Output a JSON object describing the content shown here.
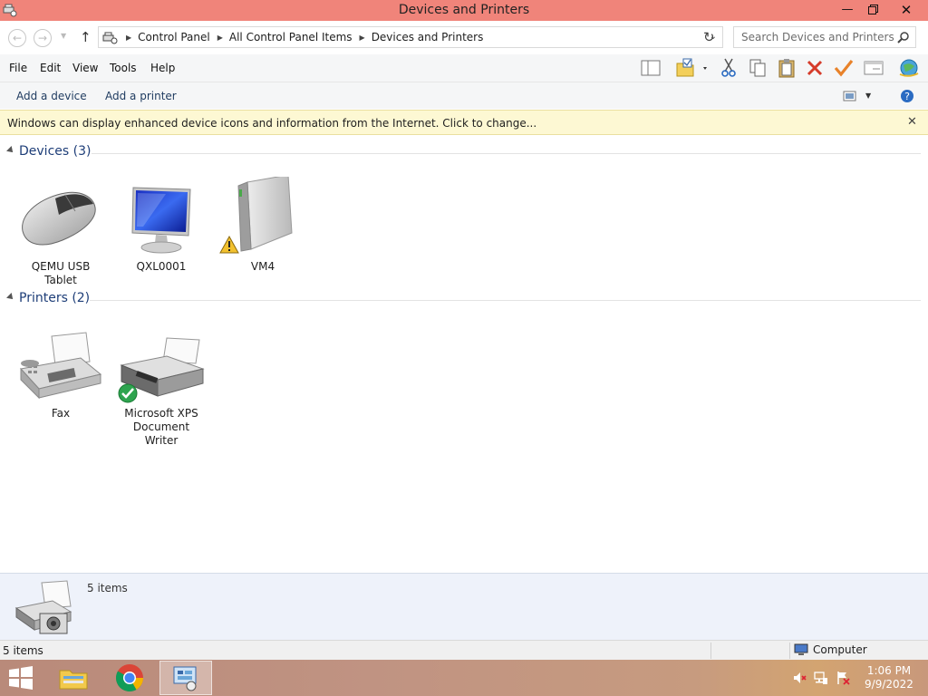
{
  "window": {
    "title": "Devices and Printers"
  },
  "address": {
    "breadcrumbs": [
      "Control Panel",
      "All Control Panel Items",
      "Devices and Printers"
    ],
    "search_placeholder": "Search Devices and Printers"
  },
  "menu": [
    "File",
    "Edit",
    "View",
    "Tools",
    "Help"
  ],
  "toolbar_icons": [
    "layout-icon",
    "folder-options-icon",
    "cut-icon",
    "copy-icon",
    "paste-icon",
    "delete-icon",
    "properties-check-icon",
    "window-icon",
    "internet-icon"
  ],
  "commands": {
    "add_device": "Add a device",
    "add_printer": "Add a printer"
  },
  "infobar": {
    "message": "Windows can display enhanced device icons and information from the Internet. Click to change..."
  },
  "devices": {
    "title": "Devices (3)",
    "items": [
      {
        "label": "QEMU USB Tablet",
        "icon": "mouse-icon"
      },
      {
        "label": "QXL0001",
        "icon": "monitor-icon"
      },
      {
        "label": "VM4",
        "icon": "external-drive-icon",
        "badge": "warning-icon"
      }
    ]
  },
  "printers": {
    "title": "Printers (2)",
    "items": [
      {
        "label": "Fax",
        "icon": "fax-icon"
      },
      {
        "label": "Microsoft XPS Document Writer",
        "icon": "printer-icon",
        "badge": "default-check-icon"
      }
    ]
  },
  "details": {
    "count": "5 items"
  },
  "statusbar": {
    "items": "5 items",
    "location": "Computer"
  },
  "taskbar": {
    "apps": [
      "start-button",
      "file-explorer",
      "chrome",
      "control-panel"
    ],
    "time": "1:06 PM",
    "date": "9/9/2022"
  }
}
